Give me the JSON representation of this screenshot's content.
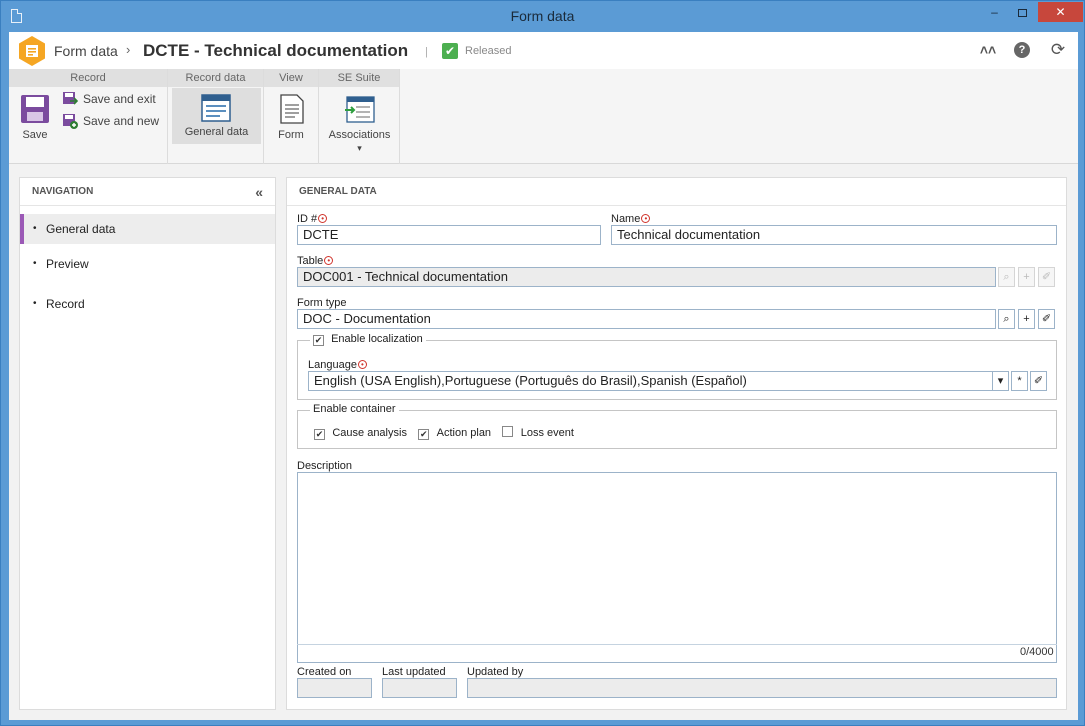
{
  "window": {
    "title": "Form data"
  },
  "header": {
    "breadcrumb": "Form data",
    "breadcrumb_sep": "›",
    "page_title": "DCTE - Technical documentation",
    "separator": "|",
    "status": "Released",
    "status_color": "#4caf50"
  },
  "ribbon": {
    "groups": [
      {
        "title": "Record"
      },
      {
        "title": "Record data"
      },
      {
        "title": "View"
      },
      {
        "title": "SE Suite"
      }
    ],
    "save_label": "Save",
    "save_exit_label": "Save and exit",
    "save_new_label": "Save and new",
    "general_data_label": "General data",
    "form_label": "Form",
    "associations_label": "Associations",
    "associations_arrow": "▾"
  },
  "navigation": {
    "title": "NAVIGATION",
    "collapse": "«",
    "items": [
      {
        "label": "General data",
        "active": true
      },
      {
        "label": "Preview",
        "active": false
      },
      {
        "label": "Record",
        "active": false
      }
    ],
    "accent": "#9b59b6"
  },
  "general": {
    "title": "GENERAL DATA",
    "id_label": "ID #",
    "id_value": "DCTE",
    "name_label": "Name",
    "name_value": "Technical documentation",
    "table_label": "Table",
    "table_value": "DOC001 - Technical documentation",
    "form_type_label": "Form type",
    "form_type_value": "DOC - Documentation",
    "enable_localization_label": "Enable localization",
    "enable_localization_checked": true,
    "language_label": "Language",
    "language_value": "English (USA English),Portuguese (Português do Brasil),Spanish (Español)",
    "enable_container_label": "Enable container",
    "cause_analysis_label": "Cause analysis",
    "cause_analysis_checked": true,
    "action_plan_label": "Action plan",
    "action_plan_checked": true,
    "loss_event_label": "Loss event",
    "loss_event_checked": false,
    "description_label": "Description",
    "description_value": "",
    "counter": "0/4000",
    "created_on_label": "Created on",
    "created_on_value": "",
    "last_updated_label": "Last updated",
    "last_updated_value": "",
    "updated_by_label": "Updated by",
    "updated_by_value": ""
  },
  "icons": {
    "search": "⌕",
    "add": "+",
    "clear": "✐",
    "dropdown": "▾",
    "asterisk": "*",
    "check": "✔",
    "required": "✱"
  }
}
